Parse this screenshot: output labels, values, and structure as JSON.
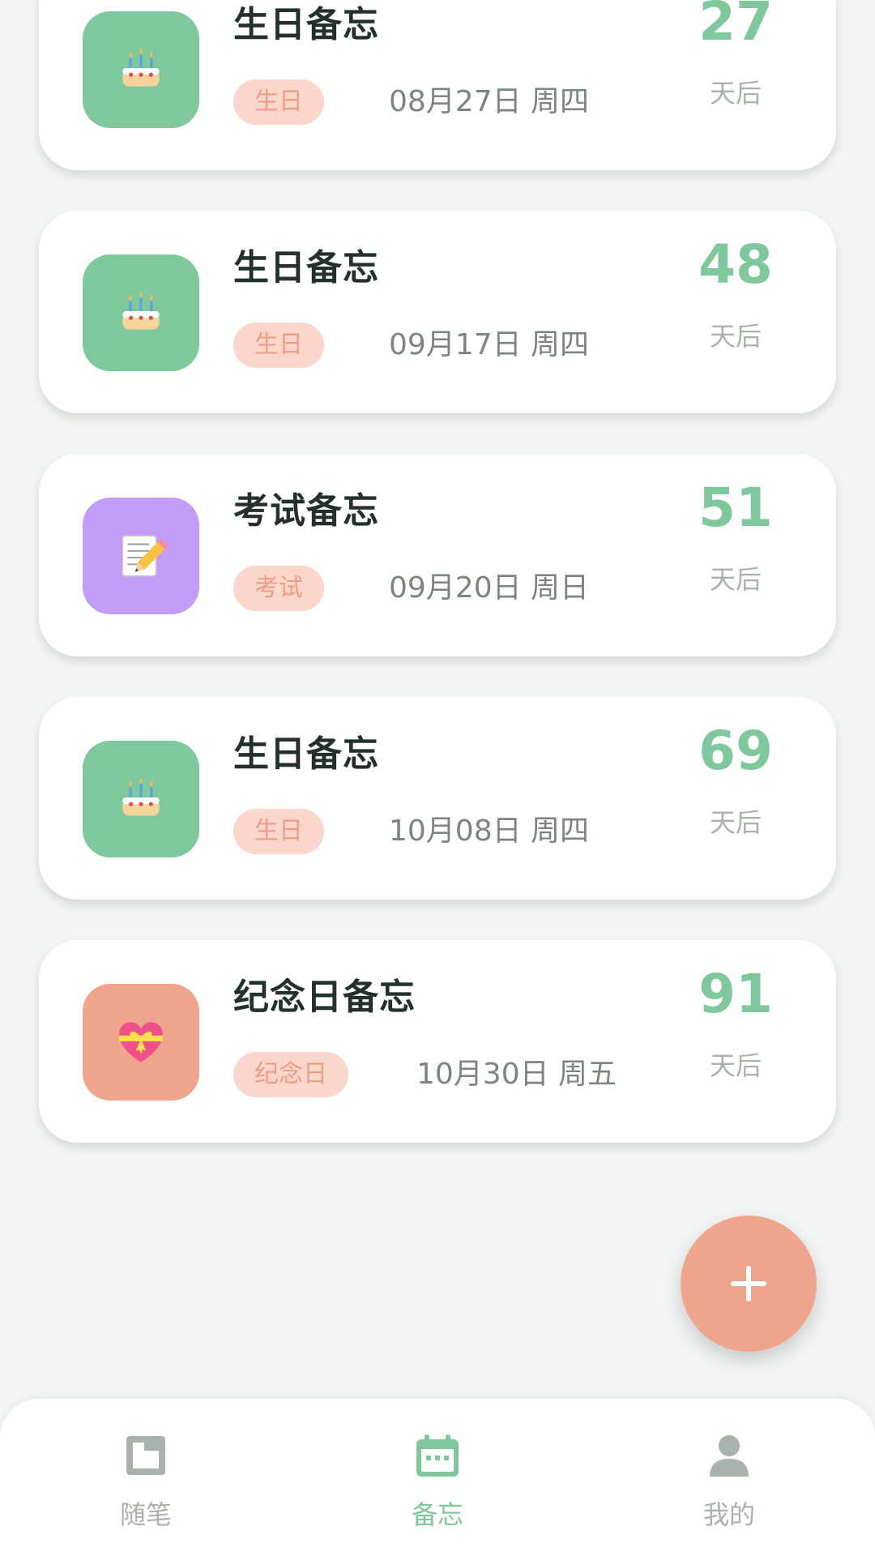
{
  "colors": {
    "accent_green": "#7fc89b",
    "accent_salmon": "#efa48c",
    "tile_purple": "#c39cf9",
    "tag_bg": "#fbd6ca",
    "tag_text": "#ec9d86",
    "title_text": "#23302c",
    "date_text": "#7b8680",
    "nav_inactive": "#a9b2ad"
  },
  "events": [
    {
      "title": "生日备忘",
      "tag": "生日",
      "date": "08月27日 周四",
      "days": "27",
      "unit": "天后",
      "icon": "birthday-cake-icon",
      "tile": "green"
    },
    {
      "title": "生日备忘",
      "tag": "生日",
      "date": "09月17日 周四",
      "days": "48",
      "unit": "天后",
      "icon": "birthday-cake-icon",
      "tile": "green"
    },
    {
      "title": "考试备忘",
      "tag": "考试",
      "date": "09月20日 周日",
      "days": "51",
      "unit": "天后",
      "icon": "memo-pencil-icon",
      "tile": "purple"
    },
    {
      "title": "生日备忘",
      "tag": "生日",
      "date": "10月08日 周四",
      "days": "69",
      "unit": "天后",
      "icon": "birthday-cake-icon",
      "tile": "green"
    },
    {
      "title": "纪念日备忘",
      "tag": "纪念日",
      "date": "10月30日 周五",
      "days": "91",
      "unit": "天后",
      "icon": "gift-heart-icon",
      "tile": "salmon"
    }
  ],
  "fab": {
    "icon": "plus-icon"
  },
  "nav": [
    {
      "label": "随笔",
      "icon": "notebook-icon",
      "active": false
    },
    {
      "label": "备忘",
      "icon": "calendar-icon",
      "active": true
    },
    {
      "label": "我的",
      "icon": "person-icon",
      "active": false
    }
  ]
}
